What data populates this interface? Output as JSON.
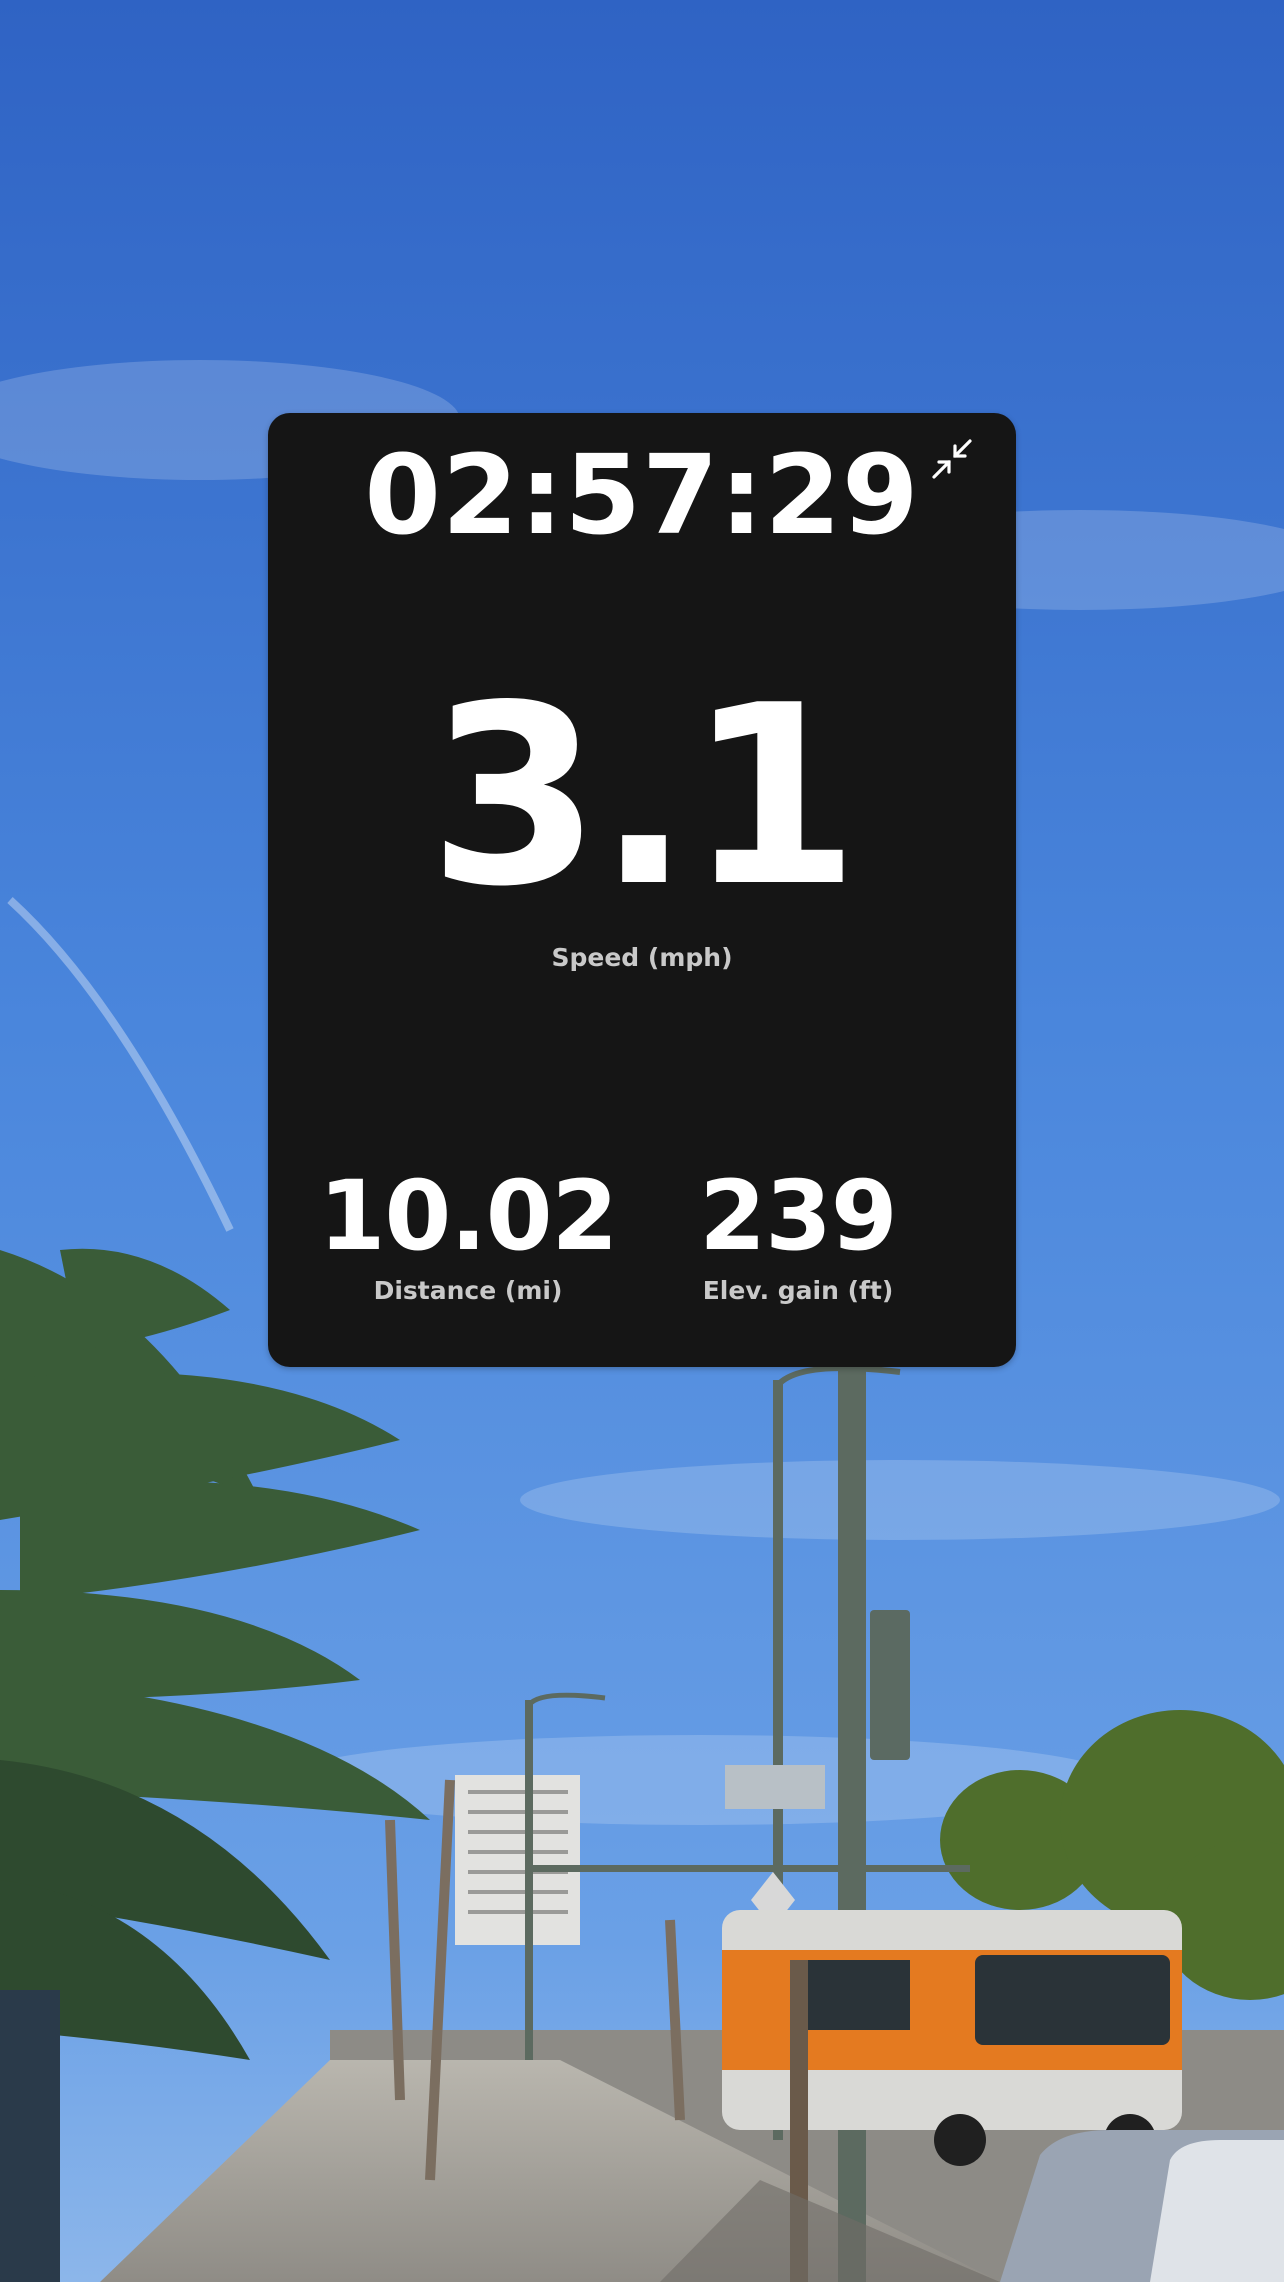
{
  "workout": {
    "elapsed_time": "02:57:29",
    "speed": {
      "value": "3.1",
      "label": "Speed (mph)"
    },
    "distance": {
      "value": "10.02",
      "label": "Distance (mi)"
    },
    "elevation": {
      "value": "239",
      "label": "Elev. gain (ft)"
    }
  },
  "controls": {
    "collapse_icon": "collapse-arrows-icon"
  },
  "colors": {
    "card_background": "#151515",
    "primary_text": "#ffffff",
    "secondary_text": "#c9c9c9",
    "sky": "#3f78d4"
  }
}
